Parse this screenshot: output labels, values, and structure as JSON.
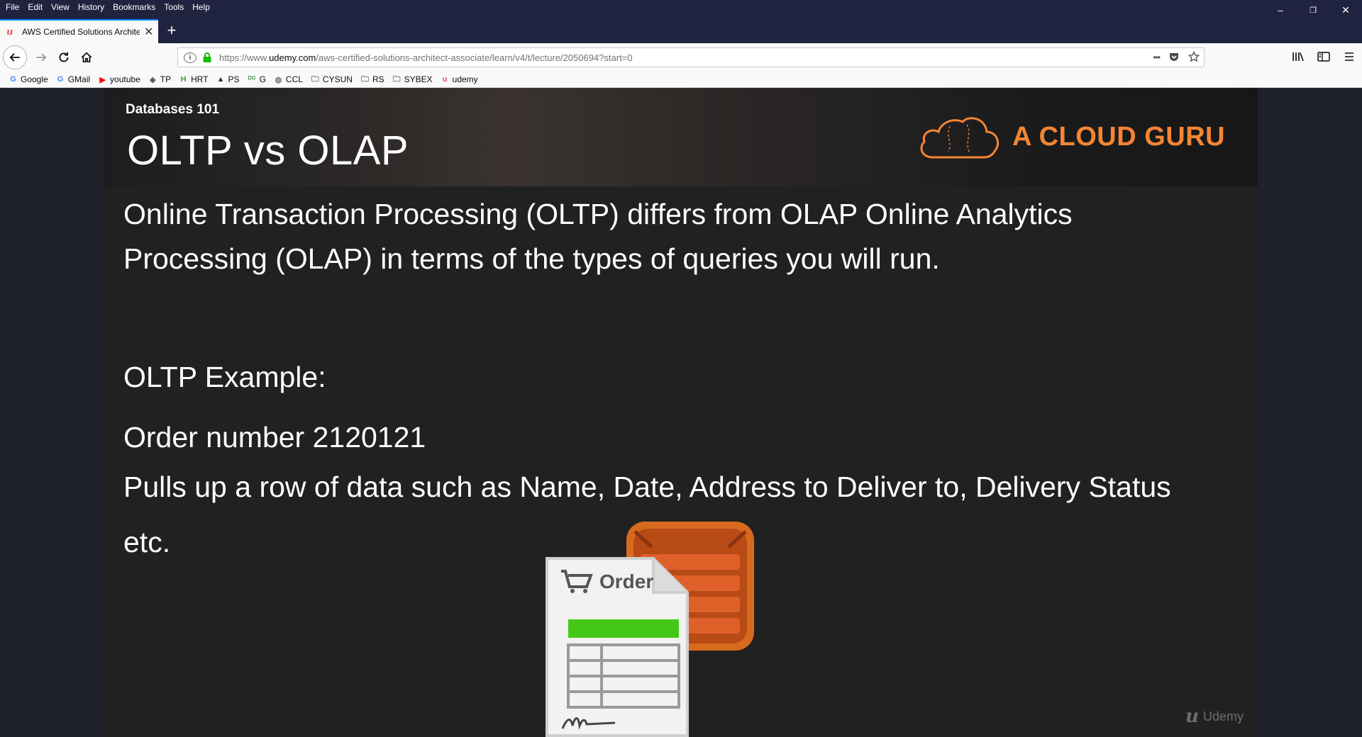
{
  "menu": [
    "File",
    "Edit",
    "View",
    "History",
    "Bookmarks",
    "Tools",
    "Help"
  ],
  "window_controls": {
    "minimize": "–",
    "restore": "❐",
    "close": "✕"
  },
  "tab": {
    "title": "AWS Certified Solutions Architect",
    "close": "✕",
    "new_tab": "+"
  },
  "nav": {
    "url_prefix": "https://www.",
    "url_domain": "udemy.com",
    "url_path": "/aws-certified-solutions-architect-associate/learn/v4/t/lecture/2050694?start=0",
    "page_actions": "•••"
  },
  "bookmarks": [
    {
      "label": "Google",
      "icon": "google-icon",
      "glyph": "G",
      "color": "#4285f4"
    },
    {
      "label": "GMail",
      "icon": "google-icon",
      "glyph": "G",
      "color": "#4285f4"
    },
    {
      "label": "youtube",
      "icon": "youtube-icon",
      "glyph": "▶",
      "color": "#ff0000"
    },
    {
      "label": "TP",
      "icon": "tp-icon",
      "glyph": "◈",
      "color": "#555555"
    },
    {
      "label": "HRT",
      "icon": "hrt-icon",
      "glyph": "H",
      "color": "#2ea44f"
    },
    {
      "label": "PS",
      "icon": "ps-icon",
      "glyph": "▲",
      "color": "#333333"
    },
    {
      "label": "G",
      "icon": "dxg-icon",
      "glyph": "ᴰᴳ",
      "color": "#4a9c4a"
    },
    {
      "label": "CCL",
      "icon": "shield-icon",
      "glyph": "◍",
      "color": "#777777"
    },
    {
      "label": "CYSUN",
      "icon": "folder-icon",
      "glyph": "🗀",
      "color": "#555555"
    },
    {
      "label": "RS",
      "icon": "folder-icon",
      "glyph": "🗀",
      "color": "#555555"
    },
    {
      "label": "SYBEX",
      "icon": "folder-icon",
      "glyph": "🗀",
      "color": "#555555"
    },
    {
      "label": "udemy",
      "icon": "udemy-icon",
      "glyph": "u",
      "color": "#ec5252"
    }
  ],
  "slide": {
    "subject": "Databases 101",
    "title": "OLTP vs OLAP",
    "brand": "A CLOUD GURU",
    "lines": [
      "Online Transaction Processing (OLTP) differs from OLAP Online Analytics",
      "Processing (OLAP) in terms of the types of queries you will run.",
      "OLTP Example:",
      "Order number 2120121",
      "Pulls up a row of data such as Name, Date, Address to Deliver to, Delivery Status",
      "etc."
    ],
    "order_label": "Order",
    "watermark": "Udemy"
  },
  "colors": {
    "browser_chrome": "#202340",
    "accent_tab": "#0a84ff",
    "brand_orange": "#f58534",
    "order_green": "#44c818",
    "db_orange": "#c8521a"
  }
}
